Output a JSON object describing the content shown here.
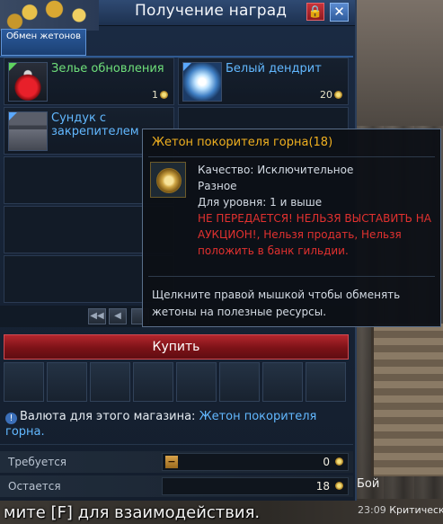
{
  "window": {
    "title": "Получение наград",
    "tab_label": "Обмен жетонов"
  },
  "items": [
    {
      "name": "Зелье обновления",
      "count": "1",
      "grade": "green"
    },
    {
      "name": "Белый дендрит",
      "count": "20",
      "grade": "blue"
    },
    {
      "name": "Сундук с закрепителем",
      "count": "",
      "grade": "blue"
    }
  ],
  "buy_label": "Купить",
  "currency": {
    "prefix": "Валюта для этого магазина:",
    "name": "Жетон покорителя горна."
  },
  "rows": {
    "required_label": "Требуется",
    "required_value": "0",
    "remaining_label": "Остается",
    "remaining_value": "18"
  },
  "tooltip": {
    "title": "Жетон покорителя горна(18)",
    "quality": "Качество: Исключительное",
    "type": "Разное",
    "level": "Для уровня: 1 и выше",
    "warn1": "НЕ ПЕРЕДАЕТСЯ! НЕЛЬЗЯ ВЫСТАВИТЬ НА",
    "warn2": "АУКЦИОН!, Нельзя продать, Нельзя",
    "warn3": "положить в банк гильдии.",
    "desc1": "Щелкните правой мышкой чтобы обменять",
    "desc2": "жетоны на полезные ресурсы."
  },
  "background": {
    "combat_time": "23:09",
    "combat_text": "Критически",
    "boi": "Бой",
    "hint": "мите [F] для взаимодействия."
  }
}
